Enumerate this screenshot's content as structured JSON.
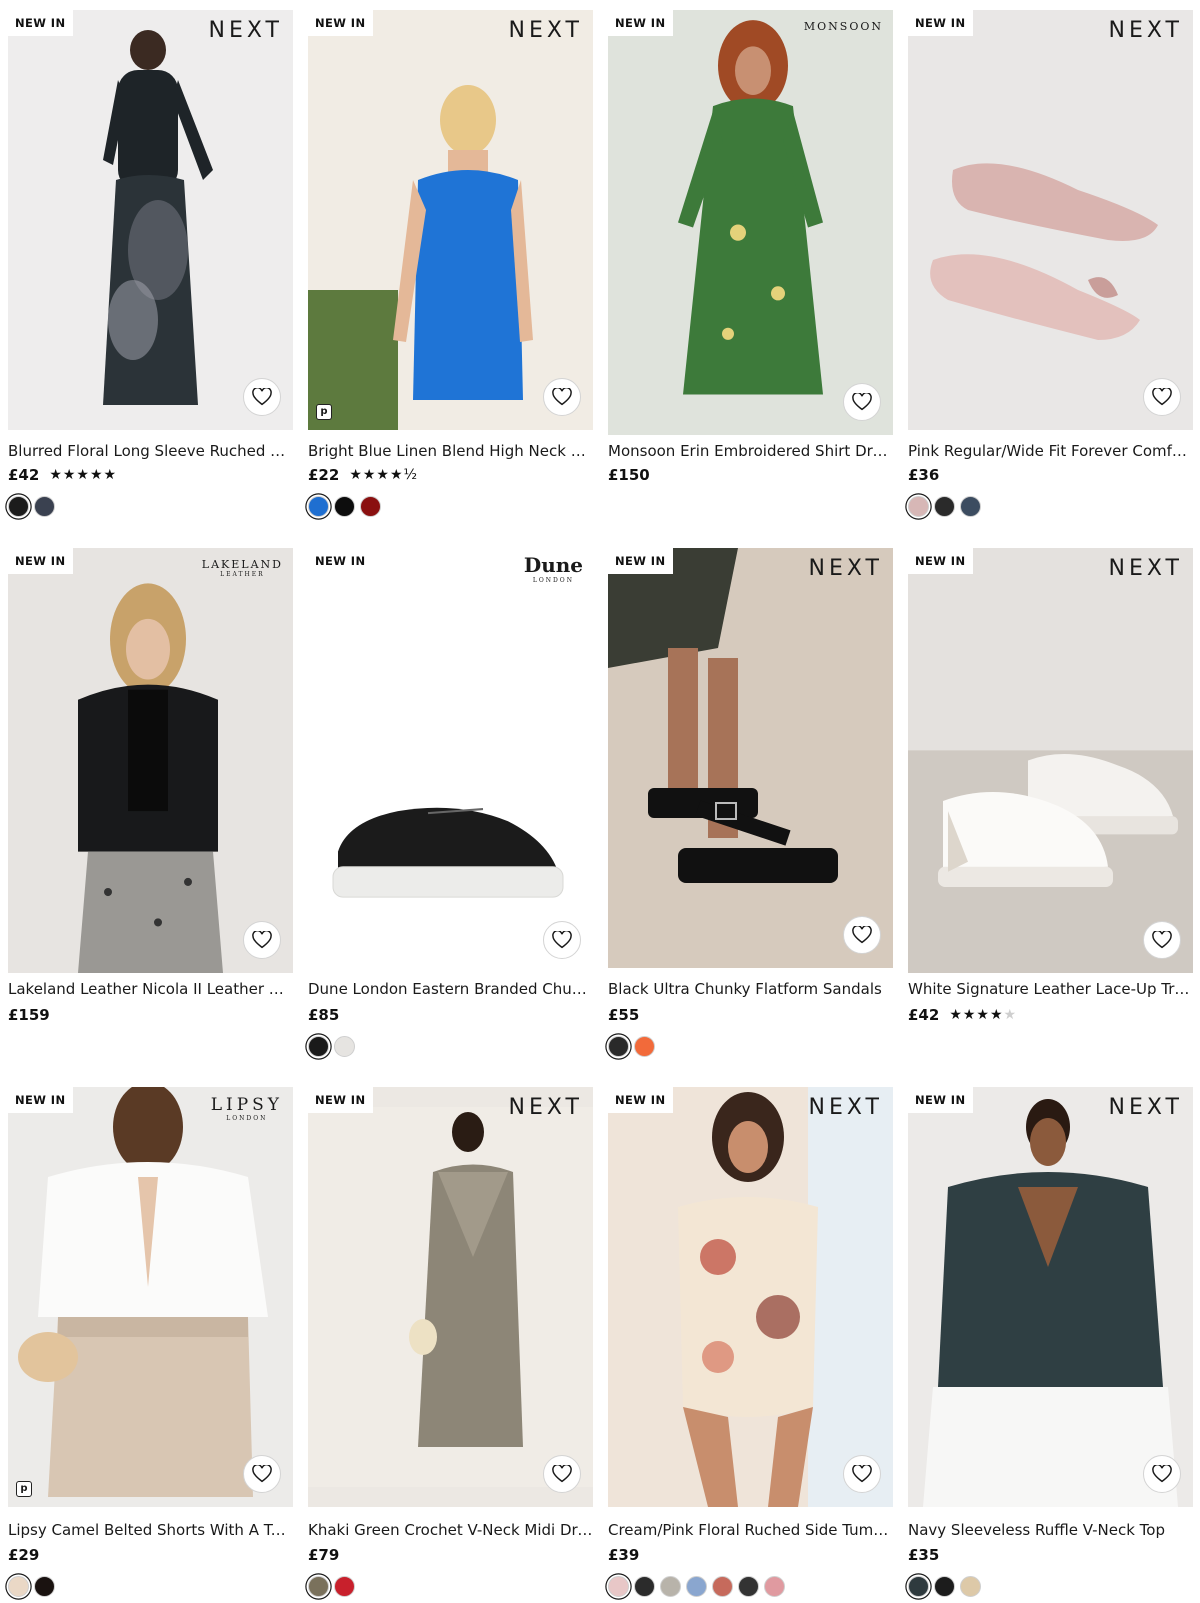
{
  "products": [
    {
      "badge": "NEW IN",
      "brand": "NEXT",
      "name": "Blurred Floral Long Sleeve Ruched Mesh Maxi Dress",
      "price": "£42",
      "stars": "★★★★★",
      "stars_off": "",
      "rating": 5,
      "swatches": [
        "#1c1c1c",
        "#3a4150"
      ],
      "selected": 0,
      "bg": "#eeeded",
      "fav_label": "♡"
    },
    {
      "badge": "NEW IN",
      "brand": "NEXT",
      "name": "Bright Blue Linen Blend High Neck Mini Dress",
      "price": "£22",
      "stars": "★★★★½",
      "stars_off": "",
      "rating": 4.5,
      "swatches": [
        "#1f6fd1",
        "#0d0d0d",
        "#8a1010"
      ],
      "selected": 0,
      "bg": "#cfe0ee",
      "fav_label": "♡",
      "pmark": "p"
    },
    {
      "badge": "NEW IN",
      "brand": "MONSOON",
      "name": "Monsoon Erin Embroidered Shirt Dress",
      "price": "£150",
      "stars": "",
      "stars_off": "",
      "swatches": [],
      "bg": "#dfe3dc",
      "fav_label": "♡"
    },
    {
      "badge": "NEW IN",
      "brand": "NEXT",
      "name": "Pink Regular/Wide Fit Forever Comfort Flat Shoes",
      "price": "£36",
      "stars": "",
      "stars_off": "",
      "swatches": [
        "#d7b7b6",
        "#2a2a2a",
        "#3c4c60"
      ],
      "selected": 0,
      "bg": "#e9e7e6",
      "fav_label": "♡"
    },
    {
      "badge": "NEW IN",
      "brand": "LAKELAND",
      "brand_sub": "LEATHER",
      "name": "Lakeland Leather Nicola II Leather Biker Jacket",
      "price": "£159",
      "stars": "",
      "stars_off": "",
      "swatches": [],
      "bg": "#e7e4e1",
      "fav_label": "♡"
    },
    {
      "badge": "NEW IN",
      "brand": "Dune",
      "brand_sub": "LONDON",
      "name": "Dune London Eastern Branded Chunky Trainers",
      "price": "£85",
      "stars": "",
      "stars_off": "",
      "swatches": [
        "#1a1a1a",
        "#e6e4e1"
      ],
      "selected": 0,
      "bg": "#ffffff",
      "fav_label": "♡"
    },
    {
      "badge": "NEW IN",
      "brand": "NEXT",
      "name": "Black Ultra Chunky Flatform Sandals",
      "price": "£55",
      "stars": "",
      "stars_off": "",
      "swatches": [
        "#2a2a2a",
        "#f26a3a"
      ],
      "selected": 0,
      "bg": "#d8cfc5",
      "fav_label": "♡"
    },
    {
      "badge": "NEW IN",
      "brand": "NEXT",
      "name": "White Signature Leather Lace-Up Trainers",
      "price": "£42",
      "stars": "★★★★",
      "stars_off": "★",
      "rating": 4,
      "swatches": [],
      "bg": "#e4e1de",
      "fav_label": "♡"
    },
    {
      "badge": "NEW IN",
      "brand": "LIPSY",
      "brand_sub": "LONDON",
      "name": "Lipsy Camel Belted Shorts With A Turn Up",
      "price": "£29",
      "stars": "",
      "stars_off": "",
      "swatches": [
        "#ead8c6",
        "#1a1210"
      ],
      "selected": 0,
      "bg": "#ecebe9",
      "fav_label": "♡",
      "pmark": "p"
    },
    {
      "badge": "NEW IN",
      "brand": "NEXT",
      "name": "Khaki Green Crochet V-Neck Midi Dress",
      "price": "£79",
      "stars": "",
      "stars_off": "",
      "swatches": [
        "#7a715c",
        "#c8202c"
      ],
      "selected": 0,
      "bg": "#ece8e3",
      "fav_label": "♡"
    },
    {
      "badge": "NEW IN",
      "brand": "NEXT",
      "name": "Cream/Pink Floral Ruched Side Tummy Control Swimsuit",
      "price": "£39",
      "stars": "",
      "stars_off": "",
      "swatches": [
        "#e8c7c7",
        "#2b2b2b",
        "#b8b3aa",
        "#8aa6cf",
        "#c66a5c",
        "#333333",
        "#e09aa0"
      ],
      "selected": 0,
      "bg": "#e6dcd2",
      "fav_label": "♡"
    },
    {
      "badge": "NEW IN",
      "brand": "NEXT",
      "name": "Navy Sleeveless Ruffle V-Neck Top",
      "price": "£35",
      "stars": "",
      "stars_off": "",
      "swatches": [
        "#2f3a3e",
        "#1c1c1c",
        "#ddc9a8"
      ],
      "selected": 0,
      "bg": "#eceae8",
      "fav_label": "♡"
    }
  ]
}
